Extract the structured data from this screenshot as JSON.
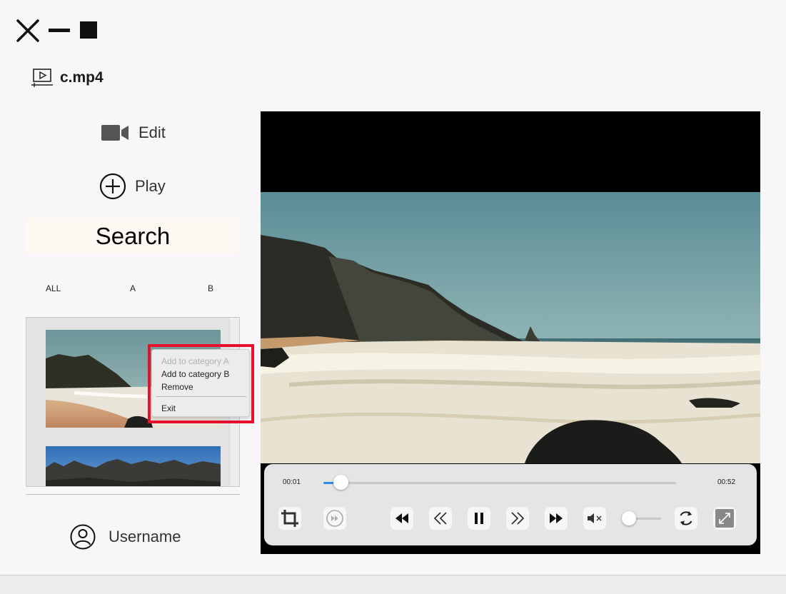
{
  "window": {
    "close_icon": "close-x-icon",
    "minimize_icon": "minimize-icon",
    "maximize_icon": "maximize-square-icon"
  },
  "file": {
    "icon": "video-file-icon",
    "name": "c.mp4"
  },
  "sidebar": {
    "edit": {
      "icon": "video-camera-icon",
      "label": "Edit"
    },
    "play": {
      "icon": "plus-circle-icon",
      "label": "Play"
    },
    "search": {
      "label": "Search"
    },
    "filters": [
      "ALL",
      "A",
      "B"
    ],
    "user": {
      "icon": "user-icon",
      "label": "Username"
    }
  },
  "context_menu": {
    "items": [
      "Add to category A",
      "Add to category B",
      "Remove"
    ],
    "exit": "Exit",
    "highlight_color": "#e8112d"
  },
  "player": {
    "current_time": "00:01",
    "total_time": "00:52",
    "progress": 0.05,
    "volume": 0,
    "accent": "#2b8cf0",
    "buttons": [
      "crop-icon",
      "speed-icon",
      "skip-back-icon",
      "rewind-icon",
      "pause-icon",
      "fast-forward-icon",
      "skip-forward-icon",
      "muted-icon",
      "loop-icon",
      "fullscreen-icon"
    ]
  }
}
